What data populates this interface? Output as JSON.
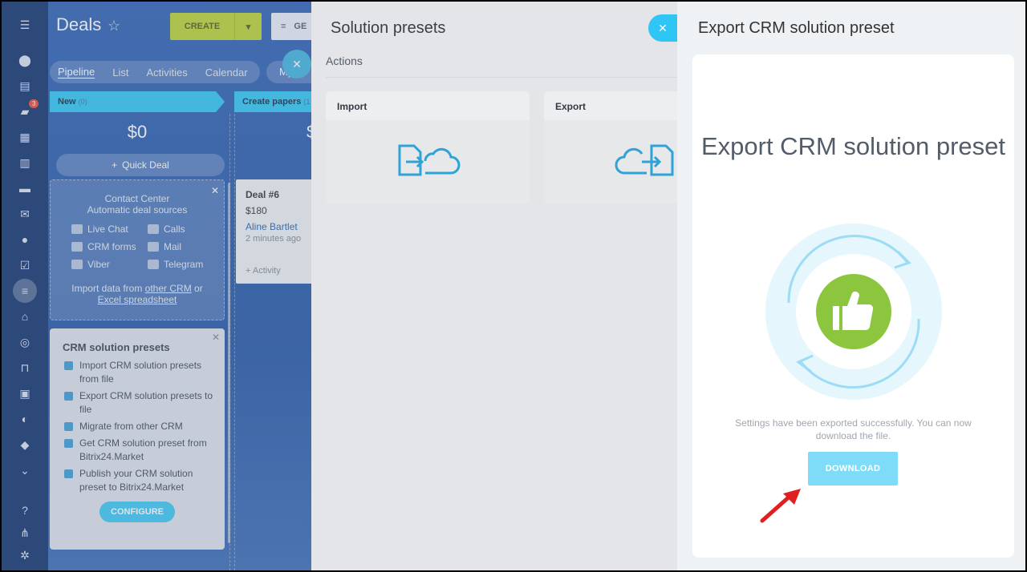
{
  "deals": {
    "title": "Deals",
    "create_label": "CREATE",
    "filter_label": "GE",
    "tabs": [
      {
        "label": "Pipeline",
        "active": true
      },
      {
        "label": "List"
      },
      {
        "label": "Activities"
      },
      {
        "label": "Calendar"
      }
    ],
    "my_tab": "My",
    "stages": [
      {
        "name": "New",
        "count": "(0)",
        "sum": "$0"
      },
      {
        "name": "Create papers",
        "count": "(1",
        "sum": "$"
      }
    ],
    "quick_deal": "Quick Deal",
    "contact_center": {
      "title_line1": "Contact Center",
      "title_line2": "Automatic deal sources",
      "sources": [
        "Live Chat",
        "Calls",
        "CRM forms",
        "Mail",
        "Viber",
        "Telegram"
      ],
      "import_prefix": "Import data from",
      "import_link1": "other CRM",
      "import_or": "or",
      "import_link2": "Excel spreadsheet"
    },
    "presets_box": {
      "title": "CRM solution presets",
      "items": [
        "Import CRM solution presets from file",
        "Export CRM solution presets to file",
        "Migrate from other CRM",
        "Get CRM solution preset from Bitrix24.Market",
        "Publish your CRM solution preset to Bitrix24.Market"
      ],
      "configure_label": "CONFIGURE"
    },
    "deal_card": {
      "name": "Deal #6",
      "amount": "$180",
      "person": "Aline Bartlet",
      "time": "2 minutes ago",
      "activity": "+ Activity"
    },
    "rail_badge": "3"
  },
  "solution_presets": {
    "title": "Solution presets",
    "section": "Actions",
    "cards": [
      {
        "label": "Import",
        "icon": "import-cloud-icon"
      },
      {
        "label": "Export",
        "icon": "export-cloud-icon"
      }
    ]
  },
  "export": {
    "panel_title": "Export CRM solution preset",
    "heading": "Export CRM solution preset",
    "message": "Settings have been exported successfully. You can now download the file.",
    "download_label": "DOWNLOAD"
  },
  "colors": {
    "accent": "#2fc6f6",
    "create": "#bbd534",
    "success": "#8cc63f",
    "download": "#7fdcf9",
    "arrow": "#e02020"
  },
  "icons": {
    "close": "close-icon",
    "thumbs_up": "thumbs-up-icon",
    "star": "star-icon",
    "pointer": "red-arrow-icon"
  }
}
